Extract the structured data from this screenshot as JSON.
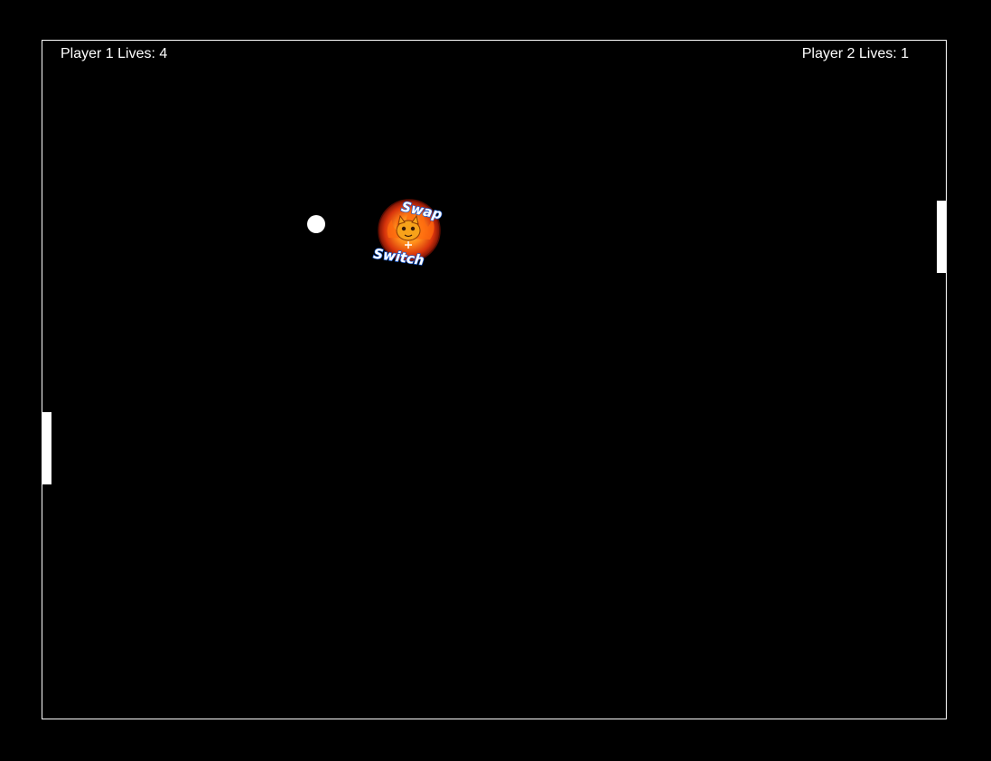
{
  "hud": {
    "player1_lives": "Player 1 Lives: 4",
    "player2_lives": "Player 2 Lives: 1"
  },
  "powerup": {
    "icon": "swap-switch-powerup-icon",
    "label_top": "Swap",
    "label_bottom": "Switch"
  },
  "colors": {
    "background": "#000000",
    "foreground": "#ffffff",
    "powerup_fire": "#e0430f",
    "powerup_text_outline": "#1a5fd6"
  }
}
